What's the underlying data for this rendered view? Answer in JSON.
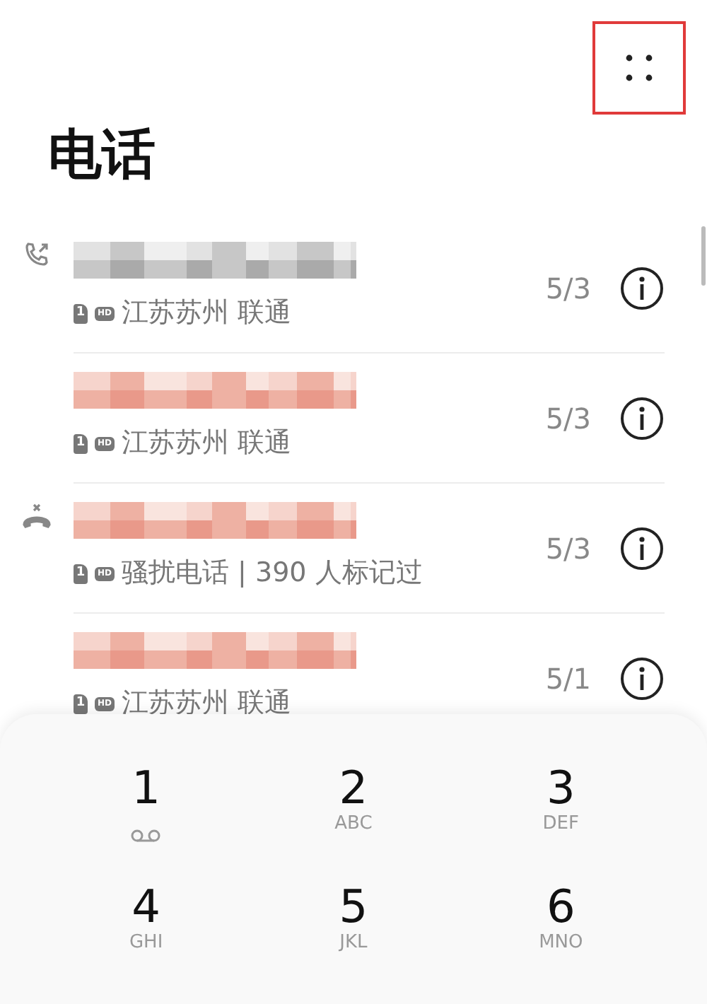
{
  "header": {
    "menu_highlighted": true
  },
  "title": "电话",
  "calls": [
    {
      "kind": "outgoing",
      "missed": false,
      "sim": "1",
      "hd": "HD",
      "detail": "江苏苏州 联通",
      "date": "5/3"
    },
    {
      "kind": "plain",
      "missed": true,
      "sim": "1",
      "hd": "HD",
      "detail": "江苏苏州 联通",
      "date": "5/3"
    },
    {
      "kind": "rejected",
      "missed": true,
      "sim": "1",
      "hd": "HD",
      "detail": "骚扰电话 | 390 人标记过",
      "date": "5/3"
    },
    {
      "kind": "plain",
      "missed": true,
      "sim": "1",
      "hd": "HD",
      "detail": "江苏苏州 联通",
      "date": "5/1"
    }
  ],
  "keypad": [
    {
      "digit": "1",
      "kind": "voicemail"
    },
    {
      "digit": "2",
      "letters": "ABC",
      "kind": "letters"
    },
    {
      "digit": "3",
      "letters": "DEF",
      "kind": "letters"
    },
    {
      "digit": "4",
      "letters": "GHI",
      "kind": "letters"
    },
    {
      "digit": "5",
      "letters": "JKL",
      "kind": "letters"
    },
    {
      "digit": "6",
      "letters": "MNO",
      "kind": "letters"
    }
  ]
}
